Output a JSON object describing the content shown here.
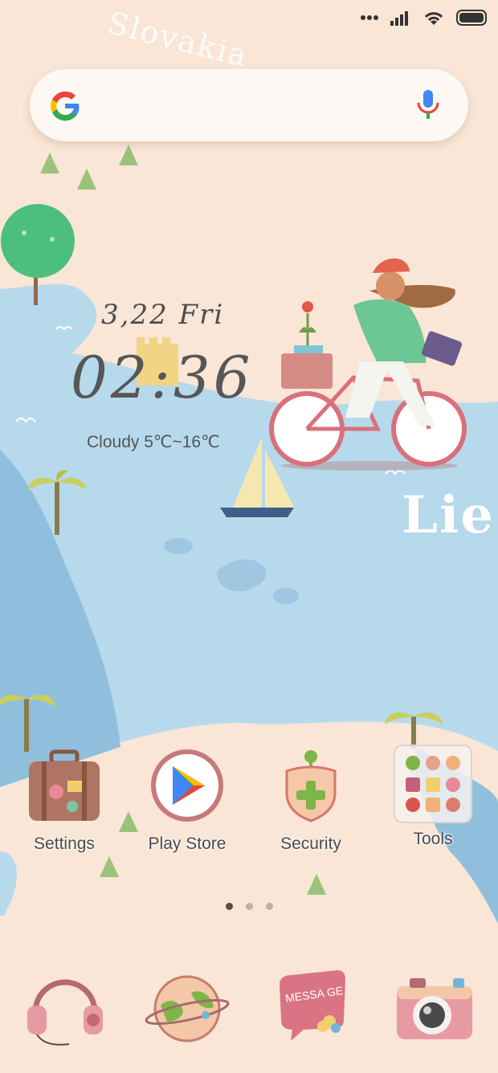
{
  "status_bar": {
    "dots_icon": "more-dots-icon",
    "signal_icon": "signal-icon",
    "wifi_icon": "wifi-icon",
    "battery_icon": "battery-icon"
  },
  "wallpaper": {
    "top_text": "Slovakia",
    "side_text": "Lie"
  },
  "search": {
    "logo_icon": "google-g-icon",
    "mic_icon": "microphone-icon"
  },
  "clock": {
    "date": "3,22 Fri",
    "time": "02:36",
    "weather": "Cloudy 5℃~16℃"
  },
  "apps": [
    {
      "label": "Settings",
      "icon": "suitcase-icon"
    },
    {
      "label": "Play Store",
      "icon": "play-store-icon"
    },
    {
      "label": "Security",
      "icon": "shield-plus-icon"
    },
    {
      "label": "Tools",
      "icon": "folder-icon"
    }
  ],
  "page_indicator": {
    "pages": 3,
    "active": 1
  },
  "dock": [
    {
      "icon": "headphones-icon"
    },
    {
      "icon": "globe-icon"
    },
    {
      "icon": "message-icon",
      "text": "MESSA GE"
    },
    {
      "icon": "camera-icon"
    }
  ],
  "colors": {
    "sand": "#f9e6d6",
    "water": "#b7d9ec",
    "deep_water": "#8fbfdc"
  }
}
